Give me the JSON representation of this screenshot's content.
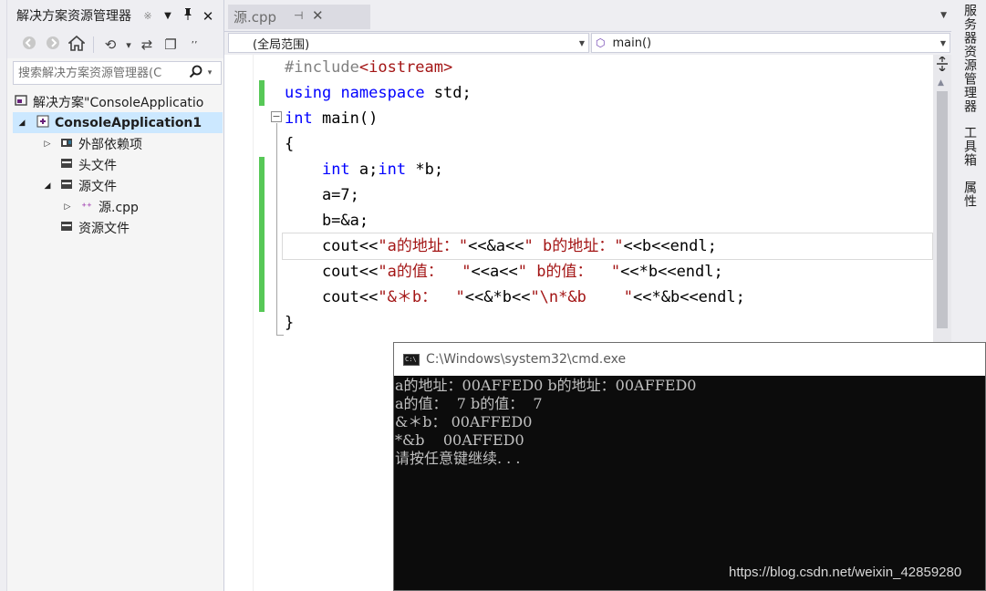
{
  "solution_explorer": {
    "title": "解决方案资源管理器",
    "pin_small": "※",
    "dropdown_glyph": "▼",
    "pin_glyph": "ꟹ",
    "close_glyph": "✕",
    "toolbar": {
      "back": "◀",
      "forward": "▶",
      "home": "⌂",
      "history": "⟲",
      "history_drop": "▾",
      "sync": "⇄",
      "collapse": "❐",
      "more": "ʼʼ"
    },
    "search_placeholder": "搜索解决方案资源管理器(C",
    "search_icon": "⚲",
    "search_drop": "▾",
    "tree": [
      {
        "label": "解决方案\"ConsoleApplicatio",
        "icon": "▣",
        "arrow": ""
      },
      {
        "label": "ConsoleApplication1",
        "icon": "⊞",
        "arrow": "◢"
      },
      {
        "label": "外部依赖项",
        "icon": "▦",
        "arrow": "▷"
      },
      {
        "label": "头文件",
        "icon": "▬",
        "arrow": ""
      },
      {
        "label": "源文件",
        "icon": "▬",
        "arrow": "◢"
      },
      {
        "label": "源.cpp",
        "icon": "⁺⁺",
        "arrow": "▷"
      },
      {
        "label": "资源文件",
        "icon": "▬",
        "arrow": ""
      }
    ]
  },
  "editor_tab": {
    "label": "源.cpp",
    "pin": "⊣",
    "close": "✕",
    "overflow": "▼"
  },
  "navigation": {
    "scope": "(全局范围)",
    "member": "main()",
    "member_icon": "⬡",
    "arrow": "▼"
  },
  "code": {
    "l1": {
      "a": "#include",
      "b": "<iostream>"
    },
    "l2": {
      "a": "using",
      "b": " ",
      "c": "namespace",
      "d": " std;"
    },
    "l3": {
      "a": "int",
      "b": " main()"
    },
    "l4": {
      "a": "{"
    },
    "l5": {
      "a": "    ",
      "b": "int",
      "c": " a;",
      "d": "int",
      "e": " *b;"
    },
    "l6": {
      "a": "    a=7;"
    },
    "l7": {
      "a": "    b=&a;"
    },
    "l8": {
      "a": "    cout<<",
      "b": "\"a的地址：\"",
      "c": "<<&a<<",
      "d": "\" b的地址：\"",
      "e": "<<b<<endl;"
    },
    "l9": {
      "a": "    cout<<",
      "b": "\"a的值：  \"",
      "c": "<<a<<",
      "d": "\" b的值：  \"",
      "e": "<<*b<<endl;"
    },
    "l10": {
      "a": "    cout<<",
      "b": "\"&＊b：  \"",
      "c": "<<&*b<<",
      "d": "\"\\n*&b    \"",
      "e": "<<*&b<<endl;"
    },
    "l11": {
      "a": "}"
    },
    "fold_glyph": "−"
  },
  "scroll": {
    "split": "⯐",
    "up": "▲"
  },
  "right_dock": {
    "server_explorer": "服务器资源管理器",
    "toolbox": "工具箱",
    "properties": "属性"
  },
  "console": {
    "title": "C:\\Windows\\system32\\cmd.exe",
    "icon_text": "C:\\",
    "lines": [
      "a的地址：00AFFED0 b的地址：00AFFED0",
      "a的值：  7 b的值：  7",
      "&＊b： 00AFFED0",
      "*&b    00AFFED0",
      "请按任意键继续. . ."
    ]
  },
  "watermark": "https://blog.csdn.net/weixin_42859280"
}
